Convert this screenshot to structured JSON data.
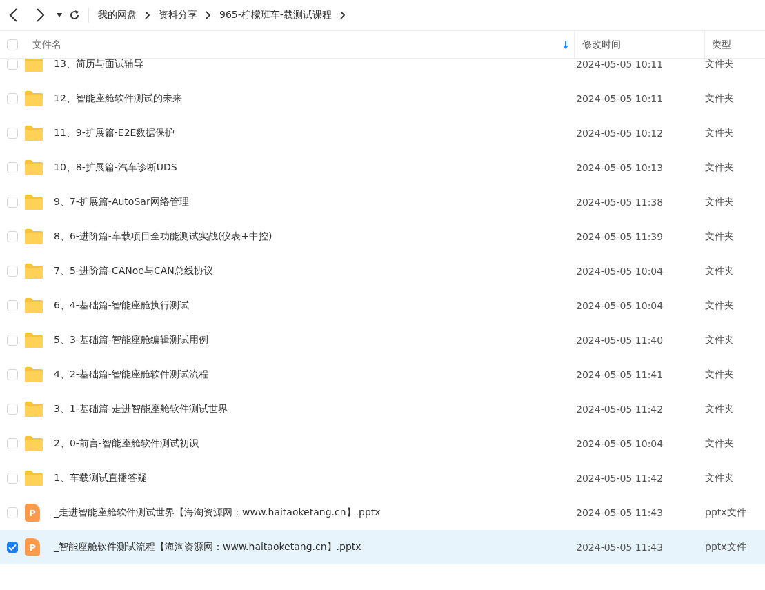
{
  "breadcrumb": [
    "我的网盘",
    "资料分享",
    "965-柠檬班车-载测试课程"
  ],
  "columns": {
    "name": "文件名",
    "modified": "修改时间",
    "type": "类型"
  },
  "all_checked": false,
  "rows": [
    {
      "kind": "folder",
      "name": "13、简历与面试辅导",
      "modified": "2024-05-05 10:11",
      "type": "文件夹",
      "selected": false
    },
    {
      "kind": "folder",
      "name": "12、智能座舱软件测试的未来",
      "modified": "2024-05-05 10:11",
      "type": "文件夹",
      "selected": false
    },
    {
      "kind": "folder",
      "name": "11、9-扩展篇-E2E数据保护",
      "modified": "2024-05-05 10:12",
      "type": "文件夹",
      "selected": false
    },
    {
      "kind": "folder",
      "name": "10、8-扩展篇-汽车诊断UDS",
      "modified": "2024-05-05 10:13",
      "type": "文件夹",
      "selected": false
    },
    {
      "kind": "folder",
      "name": "9、7-扩展篇-AutoSar网络管理",
      "modified": "2024-05-05 11:38",
      "type": "文件夹",
      "selected": false
    },
    {
      "kind": "folder",
      "name": "8、6-进阶篇-车载项目全功能测试实战(仪表+中控)",
      "modified": "2024-05-05 11:39",
      "type": "文件夹",
      "selected": false
    },
    {
      "kind": "folder",
      "name": "7、5-进阶篇-CANoe与CAN总线协议",
      "modified": "2024-05-05 10:04",
      "type": "文件夹",
      "selected": false
    },
    {
      "kind": "folder",
      "name": "6、4-基础篇-智能座舱执行测试",
      "modified": "2024-05-05 10:04",
      "type": "文件夹",
      "selected": false
    },
    {
      "kind": "folder",
      "name": "5、3-基础篇-智能座舱编辑测试用例",
      "modified": "2024-05-05 11:40",
      "type": "文件夹",
      "selected": false
    },
    {
      "kind": "folder",
      "name": "4、2-基础篇-智能座舱软件测试流程",
      "modified": "2024-05-05 11:41",
      "type": "文件夹",
      "selected": false
    },
    {
      "kind": "folder",
      "name": "3、1-基础篇-走进智能座舱软件测试世界",
      "modified": "2024-05-05 11:42",
      "type": "文件夹",
      "selected": false
    },
    {
      "kind": "folder",
      "name": "2、0-前言-智能座舱软件测试初识",
      "modified": "2024-05-05 10:04",
      "type": "文件夹",
      "selected": false
    },
    {
      "kind": "folder",
      "name": "1、车载测试直播答疑",
      "modified": "2024-05-05 11:42",
      "type": "文件夹",
      "selected": false
    },
    {
      "kind": "pptx",
      "icon_text": "P",
      "name": "_走进智能座舱软件测试世界【海淘资源网：www.haitaoketang.cn】.pptx",
      "modified": "2024-05-05 11:43",
      "type": "pptx文件",
      "selected": false
    },
    {
      "kind": "pptx",
      "icon_text": "P",
      "name": "_智能座舱软件测试流程【海淘资源网：www.haitaoketang.cn】.pptx",
      "modified": "2024-05-05 11:43",
      "type": "pptx文件",
      "selected": true
    }
  ]
}
